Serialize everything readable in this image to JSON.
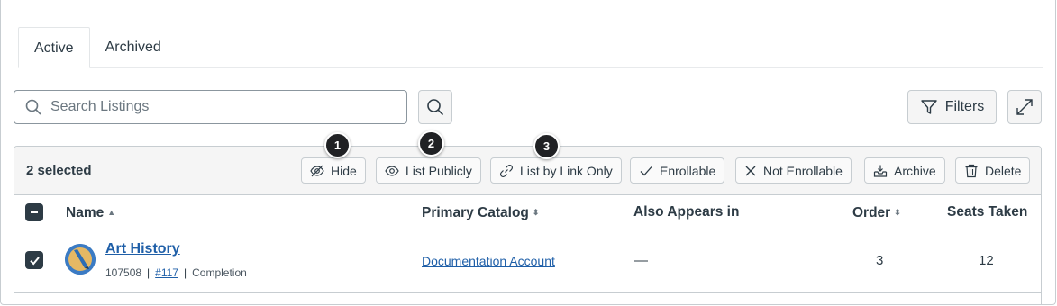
{
  "tabs": [
    {
      "label": "Active",
      "active": true
    },
    {
      "label": "Archived",
      "active": false
    }
  ],
  "search": {
    "placeholder": "Search Listings",
    "value": ""
  },
  "toolbar": {
    "filters_label": "Filters"
  },
  "bulk": {
    "selected_text": "2 selected",
    "actions": {
      "hide": "Hide",
      "list_publicly": "List Publicly",
      "list_by_link": "List by Link Only",
      "enrollable": "Enrollable",
      "not_enrollable": "Not Enrollable",
      "archive": "Archive",
      "delete": "Delete"
    }
  },
  "table": {
    "columns": {
      "name": "Name",
      "primary_catalog": "Primary Catalog",
      "also_appears": "Also Appears in",
      "order": "Order",
      "seats_taken": "Seats Taken"
    },
    "rows": [
      {
        "name": "Art History",
        "id": "107508",
        "number": "#117",
        "type": "Completion",
        "primary_catalog": "Documentation Account",
        "also_appears": "—",
        "order": "3",
        "seats_taken": "12",
        "selected": true
      }
    ]
  },
  "callouts": [
    "1",
    "2",
    "3"
  ],
  "colors": {
    "text": "#2d3b45",
    "link": "#1f5fa8",
    "border": "#c7cdd1",
    "callout": "#202124"
  }
}
